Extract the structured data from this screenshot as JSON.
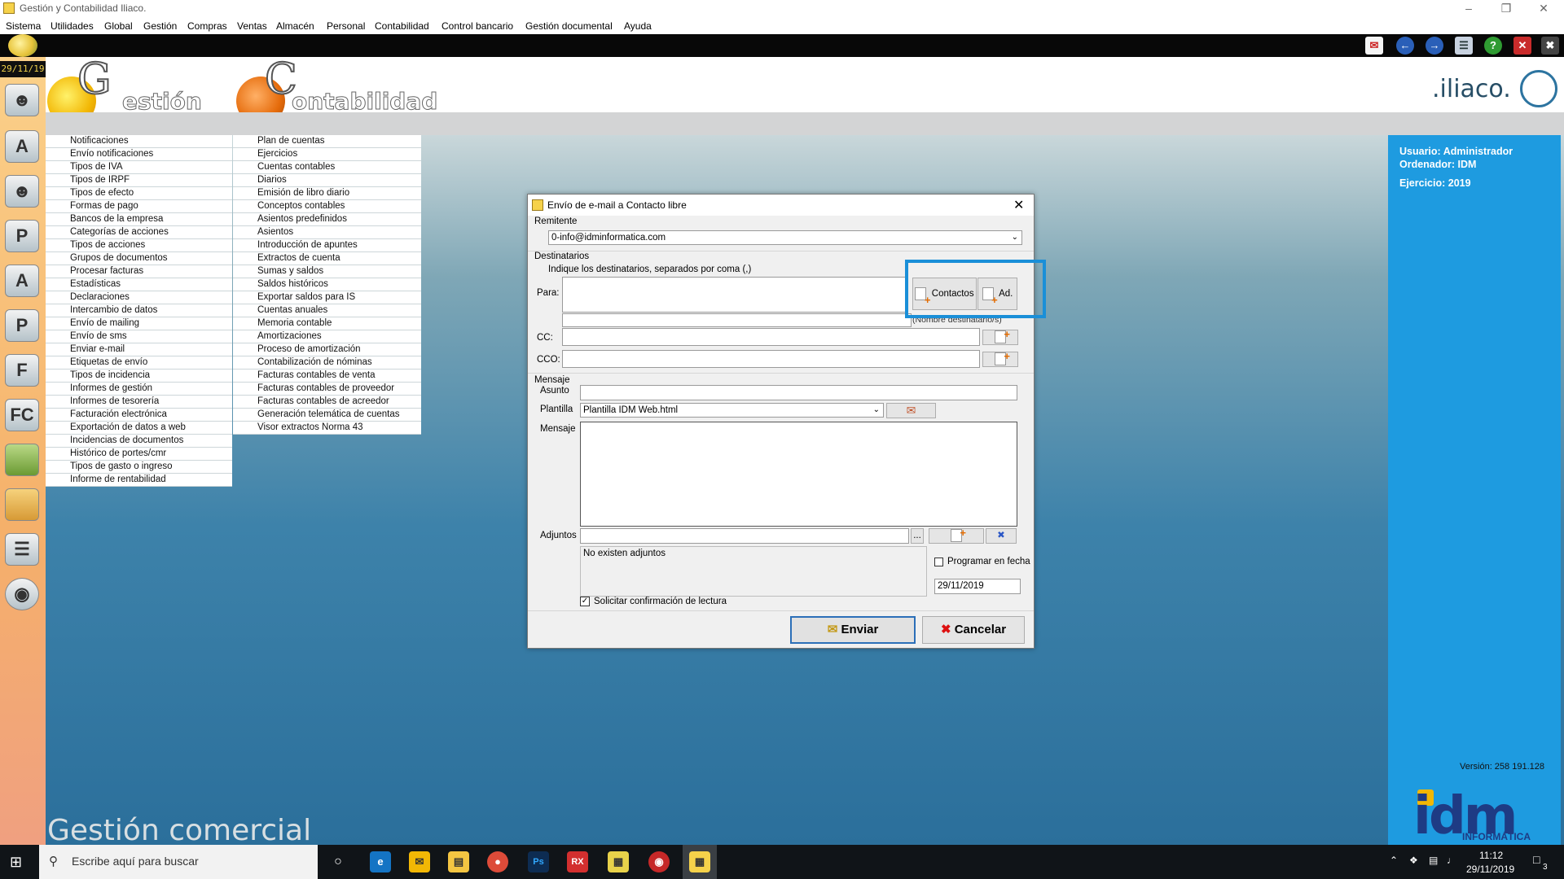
{
  "window": {
    "title": "Gestión y Contabilidad Iliaco.",
    "menu": [
      "Sistema",
      "Utilidades",
      "Global",
      "Gestión",
      "Compras",
      "Ventas",
      "Almacén",
      "Personal",
      "Contabilidad",
      "Control bancario",
      "Gestión documental",
      "Ayuda"
    ]
  },
  "sidebar": {
    "date": "29/11/19"
  },
  "header": {
    "logo_gestion_letter": "G",
    "logo_gestion_rest": "estión",
    "logo_contab_letter": "C",
    "logo_contab_rest": "ontabilidad",
    "brand": ".iliaco."
  },
  "lists": {
    "gestion": [
      "Notificaciones",
      "Envío notificaciones",
      "Tipos de IVA",
      "Tipos de IRPF",
      "Tipos de efecto",
      "Formas de pago",
      "Bancos de la empresa",
      "Categorías de acciones",
      "Tipos de acciones",
      "Grupos de documentos",
      "Procesar facturas",
      "Estadísticas",
      "Declaraciones",
      "Intercambio de datos",
      "Envío de mailing",
      "Envío de sms",
      "Enviar e-mail",
      "Etiquetas de envío",
      "Tipos de incidencia",
      "Informes de gestión",
      "Informes de tesorería",
      "Facturación electrónica",
      "Exportación de datos a web",
      "Incidencias de documentos",
      "Histórico de portes/cmr",
      "Tipos de gasto o ingreso",
      "Informe de rentabilidad"
    ],
    "contabilidad": [
      "Plan de cuentas",
      "Ejercicios",
      "Cuentas contables",
      "Diarios",
      "Emisión de libro diario",
      "Conceptos contables",
      "Asientos predefinidos",
      "Asientos",
      "Introducción de apuntes",
      "Extractos de cuenta",
      "Sumas y saldos",
      "Saldos históricos",
      "Exportar saldos para IS",
      "Cuentas anuales",
      "Memoria contable",
      "Amortizaciones",
      "Proceso de amortización",
      "Contabilización de nóminas",
      "Facturas contables de venta",
      "Facturas contables de proveedor",
      "Facturas contables de acreedor",
      "Generación telemática de cuentas",
      "Visor extractos Norma 43"
    ]
  },
  "info": {
    "usuario": "Usuario: Administrador",
    "ordenador": "Ordenador:  IDM",
    "ejercicio": "Ejercicio: 2019",
    "version": "Versión: 258 191.128",
    "idm": "idm",
    "idm_sub": "INFORMÁTICA"
  },
  "footer_label": "Gestión comercial",
  "dialog": {
    "title": "Envío de e-mail a Contacto libre",
    "remitente_label": "Remitente",
    "remitente_value": "0-info@idminformatica.com",
    "destinatarios_label": "Destinatarios",
    "hint": "Indique los destinatarios, separados por coma (,)",
    "para_label": "Para:",
    "contactos_btn": "Contactos",
    "ad_btn": "Ad.",
    "nombre_hint": "(Nombre destinatario/s)",
    "cc_label": "CC:",
    "cco_label": "CCO:",
    "mensaje_section": "Mensaje",
    "asunto_label": "Asunto",
    "plantilla_label": "Plantilla",
    "plantilla_value": "Plantilla IDM Web.html",
    "mensaje_label": "Mensaje",
    "adjuntos_label": "Adjuntos",
    "browse": "...",
    "no_adjuntos": "No existen adjuntos",
    "programar_label": "Programar en fecha",
    "programar_checked": false,
    "fecha_value": "29/11/2019",
    "confirmacion_label": "Solicitar confirmación de lectura",
    "confirmacion_checked": true,
    "enviar_btn": "Enviar",
    "cancelar_btn": "Cancelar"
  },
  "taskbar": {
    "search_placeholder": "Escribe aquí para buscar",
    "time": "11:12",
    "date": "29/11/2019",
    "notifications": "3"
  }
}
